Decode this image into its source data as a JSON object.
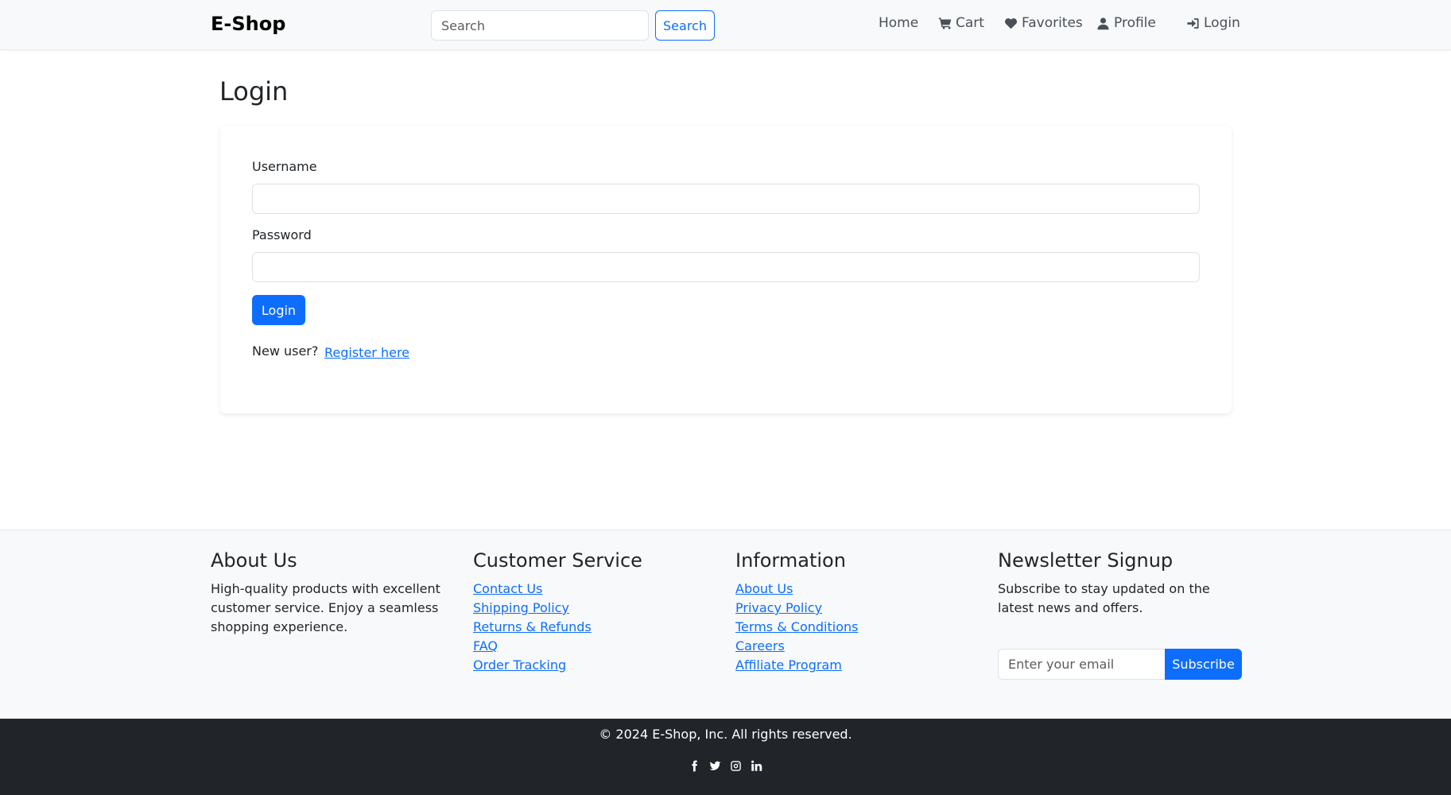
{
  "navbar": {
    "brand": "E-Shop",
    "search_placeholder": "Search",
    "search_button": "Search",
    "links": {
      "home": "Home",
      "cart": "Cart",
      "favorites": "Favorites",
      "profile": "Profile",
      "login": "Login"
    }
  },
  "main": {
    "title": "Login",
    "username_label": "Username",
    "username_value": "",
    "password_label": "Password",
    "password_value": "",
    "login_button": "Login",
    "new_user_text": "New user?",
    "register_link": "Register here"
  },
  "footer": {
    "about": {
      "title": "About Us",
      "text": "High-quality products with excellent customer service. Enjoy a seamless shopping experience."
    },
    "customer_service": {
      "title": "Customer Service",
      "links": [
        "Contact Us",
        "Shipping Policy",
        "Returns & Refunds",
        "FAQ",
        "Order Tracking"
      ]
    },
    "information": {
      "title": "Information",
      "links": [
        "About Us",
        "Privacy Policy",
        "Terms & Conditions",
        "Careers",
        "Affiliate Program"
      ]
    },
    "newsletter": {
      "title": "Newsletter Signup",
      "text": "Subscribe to stay updated on the latest news and offers.",
      "email_placeholder": "Enter your email",
      "subscribe_button": "Subscribe"
    },
    "copyright": "© 2024 E-Shop, Inc. All rights reserved.",
    "social_icons": [
      "facebook-icon",
      "twitter-icon",
      "instagram-icon",
      "linkedin-icon"
    ]
  },
  "colors": {
    "primary": "#0d6efd",
    "navbar_bg": "#f8f9fa",
    "footer_bg": "#f8f9fa",
    "bottom_bar_bg": "#212529"
  }
}
